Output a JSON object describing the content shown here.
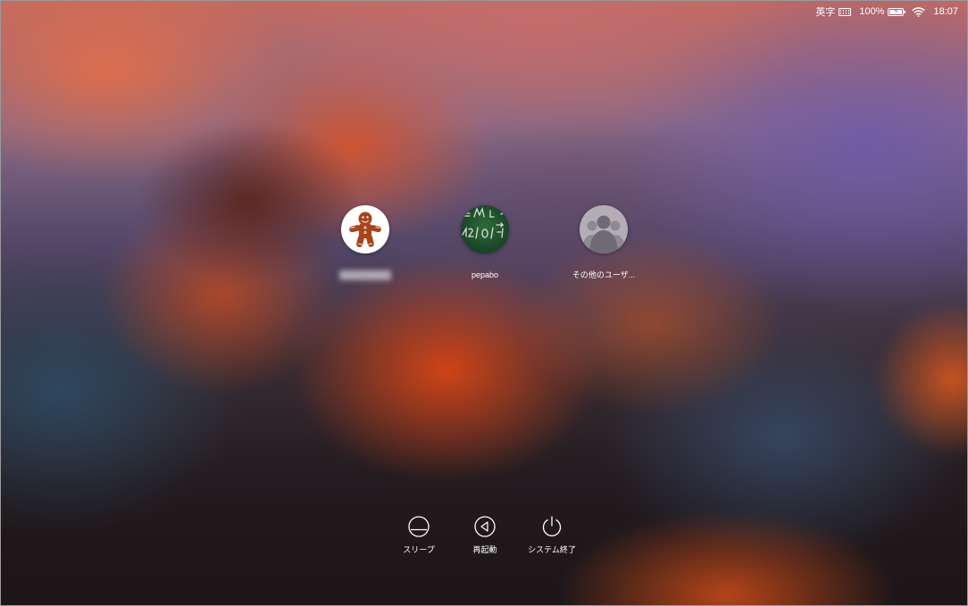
{
  "menubar": {
    "input_source_label": "英字",
    "input_source_icon": "keyboard-icon",
    "battery_percent_text": "100%",
    "battery_level": 1.0,
    "battery_icon": "battery-charging-icon",
    "wifi_icon": "wifi-icon",
    "clock": "18:07"
  },
  "users": [
    {
      "name": "",
      "name_obscured": true,
      "avatar": "gingerbread-man"
    },
    {
      "name": "pepabo",
      "avatar": "chalkboard"
    },
    {
      "name": "その他のユーザ...",
      "avatar": "generic-users"
    }
  ],
  "actions": {
    "sleep_label": "スリープ",
    "restart_label": "再起動",
    "shutdown_label": "システム終了"
  }
}
